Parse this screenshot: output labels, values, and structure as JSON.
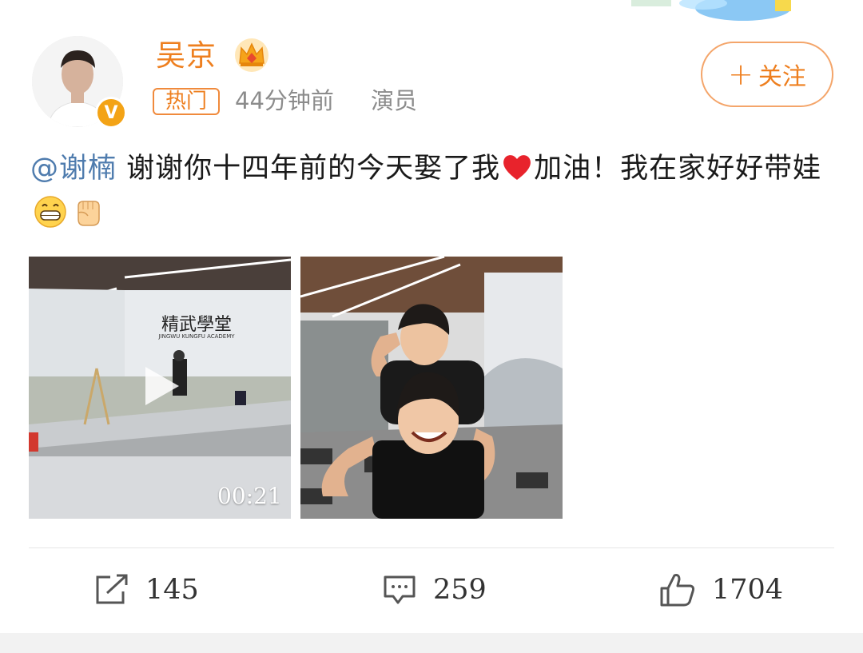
{
  "post": {
    "author": {
      "name": "吴京",
      "verified_icon": "verified-v-icon",
      "crown_icon": "crown-icon"
    },
    "badge": "热门",
    "time": "44分钟前",
    "source": "演员",
    "follow_label": "关注",
    "text": {
      "mention": "@谢楠",
      "part1": " 谢谢你十四年前的今天娶了我",
      "part2": "加油！我在家好好带娃"
    },
    "video": {
      "duration": "00:21",
      "watermark": "精武學堂",
      "watermark_sub": "JINGWU KUNGFU ACADEMY"
    },
    "actions": {
      "repost_count": "145",
      "comment_count": "259",
      "like_count": "1704"
    }
  },
  "colors": {
    "accent": "#ee7f1f",
    "mention": "#4f7cae",
    "meta": "#8c8c8c"
  }
}
